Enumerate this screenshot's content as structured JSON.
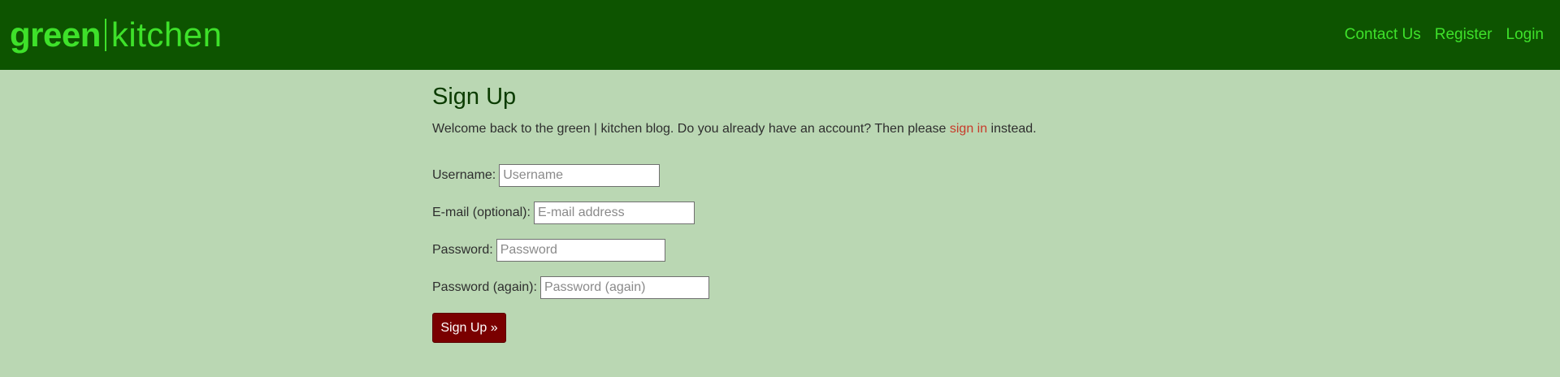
{
  "header": {
    "brand_bold": "green",
    "brand_light": "kitchen",
    "nav": [
      {
        "label": "Contact Us"
      },
      {
        "label": "Register"
      },
      {
        "label": "Login"
      }
    ]
  },
  "main": {
    "title": "Sign Up",
    "intro_before": "Welcome back to the green | kitchen blog. Do you already have an account? Then please ",
    "intro_link": "sign in",
    "intro_after": " instead.",
    "fields": [
      {
        "label": "Username:",
        "placeholder": "Username"
      },
      {
        "label": "E-mail (optional):",
        "placeholder": "E-mail address"
      },
      {
        "label": "Password:",
        "placeholder": "Password"
      },
      {
        "label": "Password (again):",
        "placeholder": "Password (again)"
      }
    ],
    "submit_label": "Sign Up »"
  },
  "colors": {
    "navbar_bg": "#0d5400",
    "brand_green": "#3ee12a",
    "page_bg": "#bad7b3",
    "button_bg": "#7a0000",
    "link_red": "#c83a2a"
  }
}
